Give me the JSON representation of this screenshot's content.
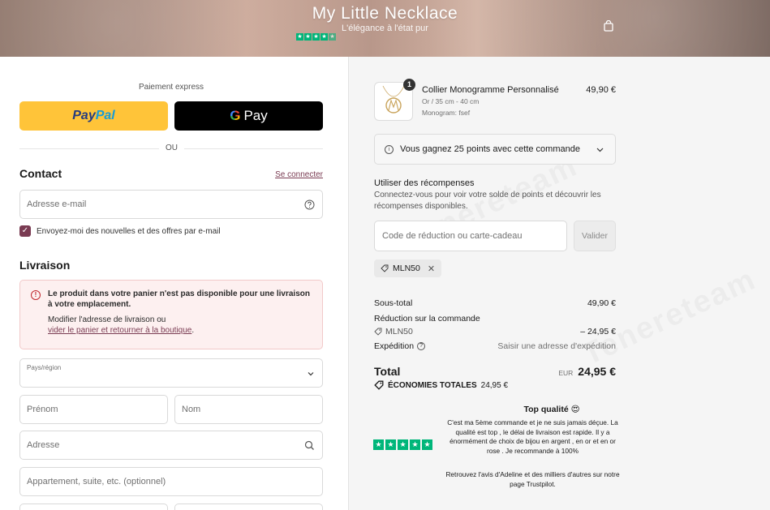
{
  "header": {
    "brand": "My Little Necklace",
    "tagline": "L'élégance à l'état pur",
    "cart_icon": "shopping-bag-icon",
    "background_color": "#a48578"
  },
  "express": {
    "label": "Paiement express",
    "paypal_part1": "Pay",
    "paypal_part2": "Pal",
    "gpay_g": "G",
    "gpay_label": "Pay",
    "or": "OU"
  },
  "contact": {
    "title": "Contact",
    "signin": "Se connecter",
    "email_placeholder": "Adresse e-mail",
    "newsletter": "Envoyez-moi des nouvelles et des offres par e-mail",
    "newsletter_checked": true
  },
  "delivery": {
    "title": "Livraison",
    "alert_title": "Le produit dans votre panier n'est pas disponible pour une livraison à votre emplacement.",
    "alert_body": "Modifier l'adresse de livraison ou",
    "alert_link": "vider le panier et retourner à la boutique",
    "alert_end": ".",
    "country_label": "Pays/région",
    "first_name": "Prénom",
    "last_name": "Nom",
    "address": "Adresse",
    "apartment": "Appartement, suite, etc. (optionnel)"
  },
  "order": {
    "product": {
      "name": "Collier Monogramme Personnalisé",
      "variant": "Or / 35 cm - 40 cm",
      "monogram": "Monogram: fsef",
      "price": "49,90 €",
      "quantity": "1"
    },
    "points_message": "Vous gagnez 25 points avec cette commande",
    "rewards_title": "Utiliser des récompenses",
    "rewards_desc": "Connectez-vous pour voir votre solde de points et découvrir les récompenses disponibles.",
    "code_placeholder": "Code de réduction ou carte-cadeau",
    "validate": "Valider",
    "applied_code": "MLN50",
    "subtotal_label": "Sous-total",
    "subtotal_value": "49,90 €",
    "discount_label": "Réduction sur la commande",
    "discount_code": "MLN50",
    "discount_value": "– 24,95 €",
    "shipping_label": "Expédition",
    "shipping_value": "Saisir une adresse d'expédition",
    "total_label": "Total",
    "total_currency": "EUR",
    "total_value": "24,95 €",
    "savings_label": "ÉCONOMIES TOTALES",
    "savings_value": "24,95 €"
  },
  "review": {
    "title": "Top qualité 😍",
    "text": "C'est ma 5ème commande et je ne suis jamais déçue. La qualité est top , le délai de livraison est rapide. Il y a énormément de choix de bijou en argent , en or et en or rose . Je recommande à 100%",
    "footer": "Retrouvez l'avis d'Adeline et des milliers d'autres sur notre page Trustpilot.",
    "stars": 5,
    "star_color": "#00b67a"
  },
  "colors": {
    "accent": "#7a3b52",
    "paypal_yellow": "#ffc439",
    "error": "#c0262d",
    "trustpilot": "#00b67a"
  }
}
